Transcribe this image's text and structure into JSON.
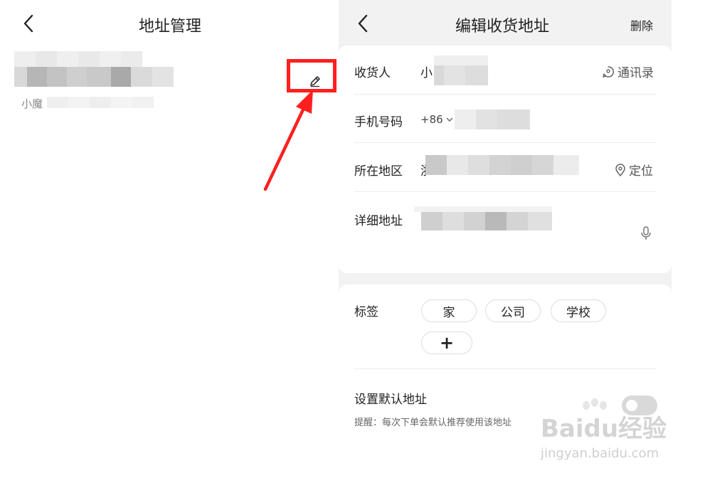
{
  "left_screen": {
    "title": "地址管理",
    "address_item": {
      "name_partial": "小魔"
    }
  },
  "right_screen": {
    "title": "编辑收货地址",
    "delete_label": "删除",
    "form": {
      "recipient": {
        "label": "收货人",
        "value_partial": "小",
        "aux_label": "通讯录"
      },
      "phone": {
        "label": "手机号码",
        "country_code": "+86"
      },
      "region": {
        "label": "所在地区",
        "value_partial": "浙",
        "aux_label": "定位"
      },
      "detail": {
        "label": "详细地址"
      }
    },
    "tags": {
      "label": "标签",
      "options": [
        "家",
        "公司",
        "学校"
      ],
      "add_symbol": "+"
    },
    "default_address": {
      "label": "设置默认地址",
      "hint": "提醒：每次下单会默认推荐使用该地址",
      "enabled": false
    }
  },
  "watermark": {
    "brand": "Baidu经验",
    "url": "jingyan.baidu.com"
  },
  "colors": {
    "highlight": "#ff1f1f",
    "arrow": "#ff1f1f",
    "page_bg_right": "#f2f2f2"
  }
}
